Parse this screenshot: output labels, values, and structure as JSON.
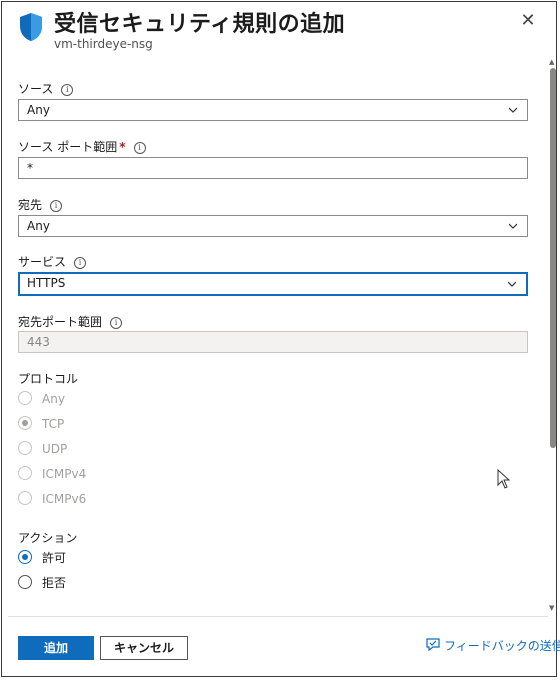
{
  "header": {
    "title": "受信セキュリティ規則の追加",
    "subtitle": "vm-thirdeye-nsg",
    "close_symbol": "✕",
    "shield_icon": "shield-icon",
    "accent": "#0f6cbd"
  },
  "form": {
    "source": {
      "label": "ソース",
      "info_symbol": "i",
      "value": "Any"
    },
    "source_port": {
      "label": "ソース ポート範囲",
      "required_mark": "*",
      "info_symbol": "i",
      "value": "*"
    },
    "destination": {
      "label": "宛先",
      "info_symbol": "i",
      "value": "Any"
    },
    "service": {
      "label": "サービス",
      "info_symbol": "i",
      "value": "HTTPS"
    },
    "destination_port": {
      "label": "宛先ポート範囲",
      "info_symbol": "i",
      "value": "443"
    },
    "protocol": {
      "label": "プロトコル",
      "options": [
        "Any",
        "TCP",
        "UDP",
        "ICMPv4",
        "ICMPv6"
      ],
      "selected": "TCP",
      "disabled": true
    },
    "action": {
      "label": "アクション",
      "options": [
        "許可",
        "拒否"
      ],
      "selected": "許可"
    }
  },
  "footer": {
    "add_label": "追加",
    "cancel_label": "キャンセル",
    "feedback_label": "フィードバックの送信",
    "feedback_icon": "feedback-icon"
  }
}
